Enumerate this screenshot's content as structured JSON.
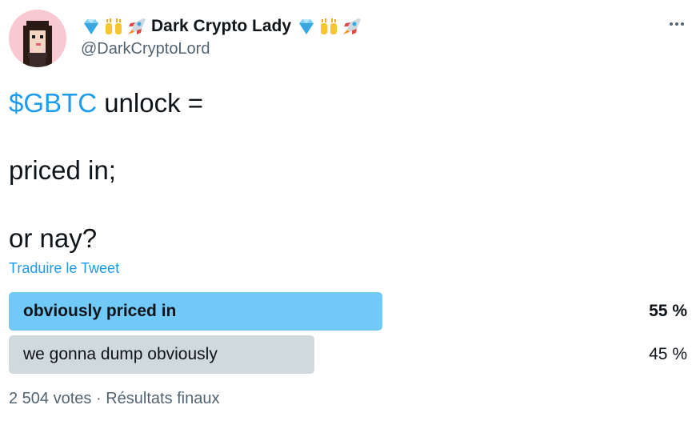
{
  "author": {
    "display_name": "Dark Crypto Lady",
    "handle": "@DarkCryptoLord",
    "name_emojis": [
      "gem-icon",
      "raised-hands-icon",
      "rocket-icon"
    ],
    "avatar_icon": "pixel-art-avatar-icon"
  },
  "menu": {
    "icon": "more-horizontal-icon"
  },
  "tweet": {
    "cashtag": "$GBTC",
    "line1_rest": " unlock =",
    "line2": "priced in;",
    "line3": "or nay?"
  },
  "translate_link": "Traduire le Tweet",
  "poll": {
    "options": [
      {
        "label": "obviously priced in",
        "percent_text": "55 %",
        "percent": 55,
        "winner": true,
        "color": "#71c9f8"
      },
      {
        "label": "we gonna dump obviously",
        "percent_text": "45 %",
        "percent": 45,
        "winner": false,
        "color": "#cfd9de"
      }
    ],
    "votes": "2 504 votes",
    "separator": " · ",
    "status": "Résultats finaux"
  },
  "colors": {
    "link": "#1d9bf0",
    "text": "#0f1419",
    "secondary": "#536471"
  }
}
